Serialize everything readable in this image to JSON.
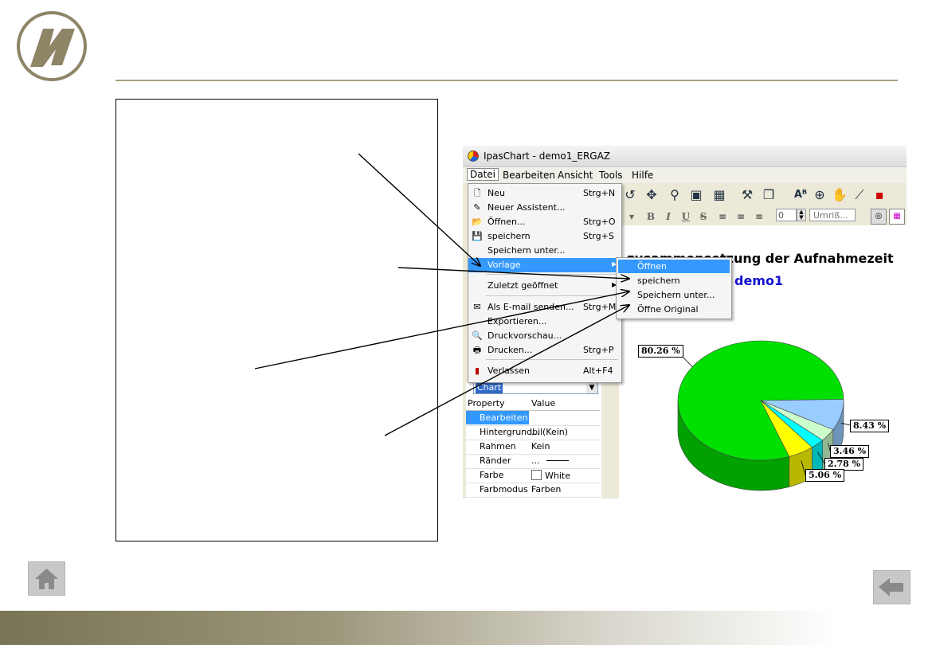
{
  "window": {
    "title": "IpasChart - demo1_ERGAZ"
  },
  "menubar": [
    "Datei",
    "Bearbeiten",
    "Ansicht",
    "Tools",
    "Hilfe"
  ],
  "datei_menu": [
    {
      "label": "Neu",
      "shortcut": "Strg+N",
      "icon": "new-document-icon"
    },
    {
      "label": "Neuer Assistent...",
      "shortcut": "",
      "icon": "wizard-icon"
    },
    {
      "label": "Öffnen...",
      "shortcut": "Strg+O",
      "icon": "open-folder-icon"
    },
    {
      "label": "speichern",
      "shortcut": "Strg+S",
      "icon": "floppy-disk-icon"
    },
    {
      "label": "Speichern unter...",
      "shortcut": "",
      "icon": ""
    },
    {
      "label": "Vorlage",
      "shortcut": "",
      "icon": "",
      "submenu": true,
      "highlighted": true
    },
    {
      "label": "Zuletzt geöffnet",
      "shortcut": "",
      "icon": "",
      "submenu": true
    },
    {
      "label": "Als E-mail senden...",
      "shortcut": "Strg+M",
      "icon": "email-icon"
    },
    {
      "label": "Exportieren...",
      "shortcut": "",
      "icon": ""
    },
    {
      "label": "Druckvorschau...",
      "shortcut": "",
      "icon": "print-preview-icon"
    },
    {
      "label": "Drucken...",
      "shortcut": "Strg+P",
      "icon": "printer-icon"
    },
    {
      "label": "Verlassen",
      "shortcut": "Alt+F4",
      "icon": "exit-door-icon"
    }
  ],
  "vorlage_submenu": [
    {
      "label": "Öffnen",
      "highlighted": true
    },
    {
      "label": "speichern"
    },
    {
      "label": "Speichern unter..."
    },
    {
      "label": "Öffne Original"
    }
  ],
  "toolbar2": {
    "spin_value": "0",
    "umriss_label": "Umriß..."
  },
  "chart": {
    "title_fragment": "…zusammensetzung der Aufnahmezeit",
    "subtitle": "demo1"
  },
  "property_panel": {
    "combo_value": "Chart",
    "col_property": "Property",
    "col_value": "Value",
    "rows": [
      {
        "name": "Bearbeiten",
        "value": "",
        "highlighted": true
      },
      {
        "name": "Hintergrundbil",
        "value": "... (Kein)"
      },
      {
        "name": "Rahmen",
        "value": "Kein"
      },
      {
        "name": "Ränder",
        "value": "..."
      },
      {
        "name": "Farbe",
        "value": "White"
      },
      {
        "name": "Farbmodus",
        "value": "Farben"
      }
    ]
  },
  "chart_data": {
    "type": "pie",
    "title": "",
    "labels": [
      "",
      "",
      "",
      "",
      ""
    ],
    "values": [
      80.26,
      8.43,
      3.46,
      2.78,
      5.06
    ],
    "value_labels": [
      "80.26 %",
      "8.43 %",
      "3.46 %",
      "2.78 %",
      "5.06 %"
    ],
    "colors": [
      "#00e000",
      "#99ccff",
      "#ccffcc",
      "#00ffff",
      "#ffff00"
    ],
    "three_d": true
  }
}
